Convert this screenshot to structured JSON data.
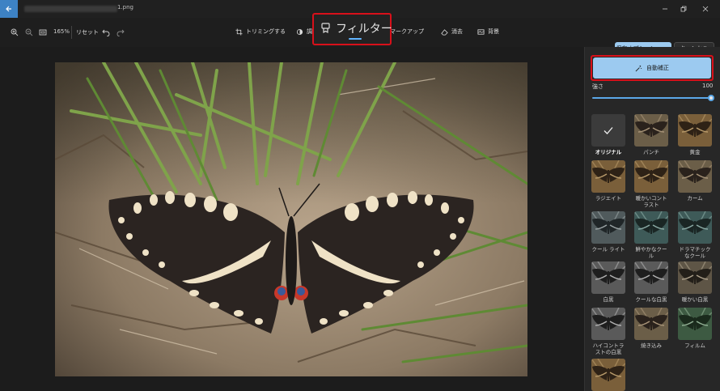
{
  "titlebar": {
    "filename_suffix": "1.png"
  },
  "toolbar": {
    "zoom": "165%",
    "reset_label": "リセット",
    "tabs": [
      {
        "id": "crop",
        "label": "トリミングする",
        "icon": "crop-icon"
      },
      {
        "id": "adjust",
        "label": "調",
        "icon": "adjust-icon"
      },
      {
        "id": "filter",
        "label": "フィルター",
        "icon": "filter-icon"
      },
      {
        "id": "markup",
        "label": "マークアップ",
        "icon": "markup-icon"
      },
      {
        "id": "erase",
        "label": "消去",
        "icon": "erase-icon"
      },
      {
        "id": "background",
        "label": "背景",
        "icon": "background-icon"
      }
    ],
    "save_label": "保存オプション",
    "cancel_label": "キャンセル"
  },
  "panel": {
    "auto_enhance_label": "自動補正",
    "strength_label": "強さ",
    "strength_value": "100",
    "strength_fraction": 1.0,
    "filters": [
      {
        "label": "オリジナル",
        "style": "original",
        "selected": true
      },
      {
        "label": "パンチ",
        "style": "color"
      },
      {
        "label": "黄金",
        "style": "warm"
      },
      {
        "label": "ラジエイト",
        "style": "warm"
      },
      {
        "label": "暖かいコントラスト",
        "style": "warm"
      },
      {
        "label": "カーム",
        "style": "color"
      },
      {
        "label": "クール ライト",
        "style": "cool"
      },
      {
        "label": "鮮やかなクール",
        "style": "teal"
      },
      {
        "label": "ドラマチックなクール",
        "style": "teal"
      },
      {
        "label": "白黒",
        "style": "mono"
      },
      {
        "label": "クールな白黒",
        "style": "mono"
      },
      {
        "label": "暖かい白黒",
        "style": "sepia"
      },
      {
        "label": "ハイコントラストの白黒",
        "style": "mono"
      },
      {
        "label": "焼き込み",
        "style": "color"
      },
      {
        "label": "フィルム",
        "style": "film"
      },
      {
        "label": "",
        "style": "warm"
      }
    ]
  },
  "colors": {
    "accent": "#9ccaf0",
    "highlight_box": "#d8101a",
    "background": "#1c1c1c"
  }
}
